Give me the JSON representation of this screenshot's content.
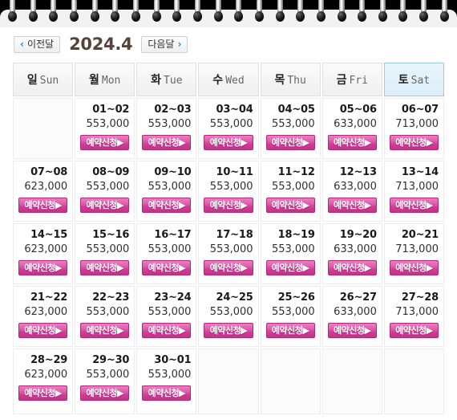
{
  "binder": {
    "ring_count": 22
  },
  "nav": {
    "prev_label": "이전달",
    "next_label": "다음달",
    "prev_chevron": "‹",
    "next_chevron": "›",
    "month_title": "2024.4"
  },
  "weekdays": [
    {
      "kr": "일",
      "en": "Sun",
      "highlight": false
    },
    {
      "kr": "월",
      "en": "Mon",
      "highlight": false
    },
    {
      "kr": "화",
      "en": "Tue",
      "highlight": false
    },
    {
      "kr": "수",
      "en": "Wed",
      "highlight": false
    },
    {
      "kr": "목",
      "en": "Thu",
      "highlight": false
    },
    {
      "kr": "금",
      "en": "Fri",
      "highlight": false
    },
    {
      "kr": "토",
      "en": "Sat",
      "highlight": true
    }
  ],
  "book_button_label": "예약신청▶",
  "colors": {
    "accent_pink": "#cf3d95",
    "saturday_header_bg": "#dbeefa",
    "chevron_blue": "#2d7fc1",
    "month_title": "#56443a"
  },
  "weeks": [
    [
      null,
      {
        "range": "01~02",
        "price": "553,000"
      },
      {
        "range": "02~03",
        "price": "553,000"
      },
      {
        "range": "03~04",
        "price": "553,000"
      },
      {
        "range": "04~05",
        "price": "553,000"
      },
      {
        "range": "05~06",
        "price": "633,000"
      },
      {
        "range": "06~07",
        "price": "713,000"
      }
    ],
    [
      {
        "range": "07~08",
        "price": "623,000"
      },
      {
        "range": "08~09",
        "price": "553,000"
      },
      {
        "range": "09~10",
        "price": "553,000"
      },
      {
        "range": "10~11",
        "price": "553,000"
      },
      {
        "range": "11~12",
        "price": "553,000"
      },
      {
        "range": "12~13",
        "price": "633,000"
      },
      {
        "range": "13~14",
        "price": "713,000"
      }
    ],
    [
      {
        "range": "14~15",
        "price": "623,000"
      },
      {
        "range": "15~16",
        "price": "553,000"
      },
      {
        "range": "16~17",
        "price": "553,000"
      },
      {
        "range": "17~18",
        "price": "553,000"
      },
      {
        "range": "18~19",
        "price": "553,000"
      },
      {
        "range": "19~20",
        "price": "633,000"
      },
      {
        "range": "20~21",
        "price": "713,000"
      }
    ],
    [
      {
        "range": "21~22",
        "price": "623,000"
      },
      {
        "range": "22~23",
        "price": "553,000"
      },
      {
        "range": "23~24",
        "price": "553,000"
      },
      {
        "range": "24~25",
        "price": "553,000"
      },
      {
        "range": "25~26",
        "price": "553,000"
      },
      {
        "range": "26~27",
        "price": "633,000"
      },
      {
        "range": "27~28",
        "price": "713,000"
      }
    ],
    [
      {
        "range": "28~29",
        "price": "623,000"
      },
      {
        "range": "29~30",
        "price": "553,000"
      },
      {
        "range": "30~01",
        "price": "553,000"
      },
      null,
      null,
      null,
      null
    ]
  ]
}
